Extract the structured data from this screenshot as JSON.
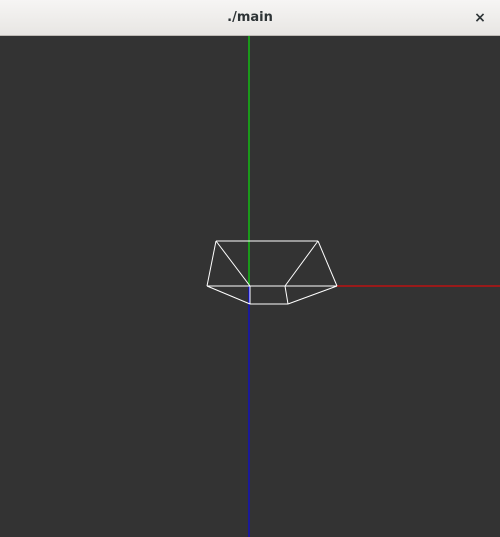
{
  "window": {
    "title": "./main",
    "close_glyph": "×",
    "close_icon": "close-icon"
  },
  "viewport": {
    "background": "#333333",
    "axes": [
      {
        "name": "x-axis",
        "color": "#ff0000"
      },
      {
        "name": "y-axis",
        "color": "#00ff00"
      },
      {
        "name": "z-axis",
        "color": "#0000ff"
      }
    ],
    "wireframe_color": "#ffffff"
  }
}
